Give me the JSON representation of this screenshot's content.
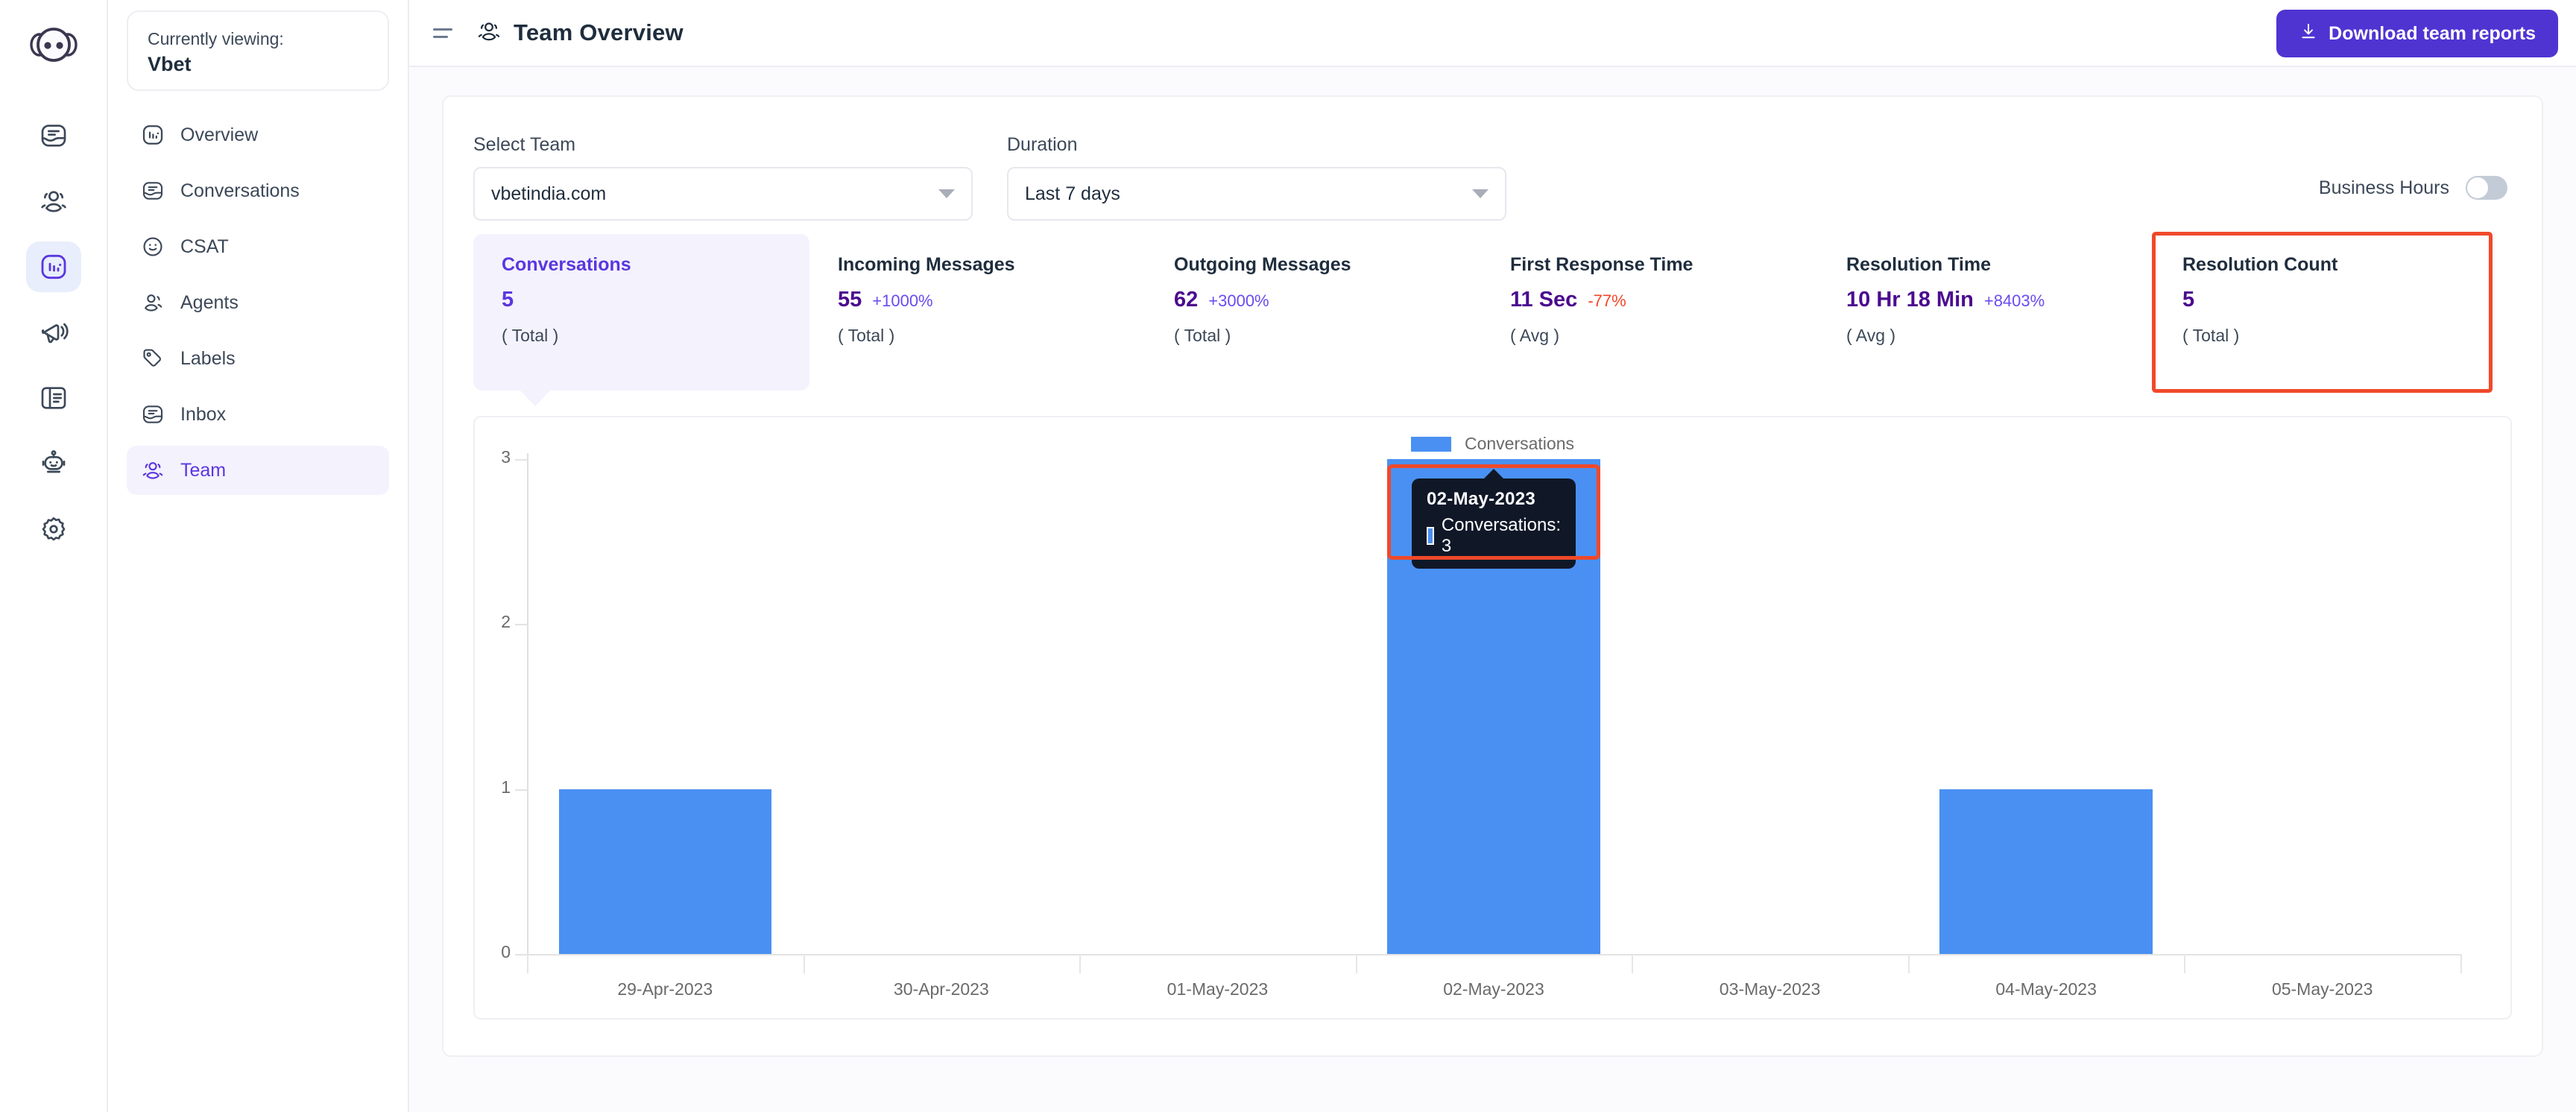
{
  "rail": {
    "logo_icon": "chatwoot-logo-icon",
    "items": [
      {
        "icon": "inbox-icon",
        "name": "inbox",
        "active": false
      },
      {
        "icon": "contacts-icon",
        "name": "contacts",
        "active": false
      },
      {
        "icon": "reports-bar-chart-icon",
        "name": "reports",
        "active": true
      },
      {
        "icon": "campaigns-megaphone-icon",
        "name": "campaigns",
        "active": false
      },
      {
        "icon": "help-center-portal-icon",
        "name": "portal",
        "active": false
      },
      {
        "icon": "bot-icon",
        "name": "bot",
        "active": false
      },
      {
        "icon": "gear-icon",
        "name": "settings",
        "active": false
      }
    ]
  },
  "sidebar": {
    "viewing_label": "Currently viewing:",
    "viewing_name": "Vbet",
    "items": [
      {
        "label": "Overview",
        "icon": "bar-chart-icon",
        "active": false
      },
      {
        "label": "Conversations",
        "icon": "inbox-icon",
        "active": false
      },
      {
        "label": "CSAT",
        "icon": "smiley-icon",
        "active": false
      },
      {
        "label": "Agents",
        "icon": "agent-icon",
        "active": false
      },
      {
        "label": "Labels",
        "icon": "tag-icon",
        "active": false
      },
      {
        "label": "Inbox",
        "icon": "inbox-icon",
        "active": false
      },
      {
        "label": "Team",
        "icon": "team-icon",
        "active": true
      }
    ]
  },
  "header": {
    "menu_icon": "hamburger-icon",
    "title_icon": "team-icon",
    "title": "Team Overview",
    "download_icon": "download-icon",
    "download_label": "Download team reports",
    "accent_color": "#4f34d2"
  },
  "filters": {
    "team": {
      "label": "Select Team",
      "value": "vbetindia.com"
    },
    "duration": {
      "label": "Duration",
      "value": "Last 7 days"
    },
    "business_hours": {
      "label": "Business Hours",
      "enabled": false
    }
  },
  "metrics": [
    {
      "name": "Conversations",
      "value": "5",
      "delta": "",
      "delta_sign": "",
      "sub": "( Total )",
      "active": true,
      "boxed": false
    },
    {
      "name": "Incoming Messages",
      "value": "55",
      "delta": "+1000%",
      "delta_sign": "pos",
      "sub": "( Total )",
      "active": false,
      "boxed": false
    },
    {
      "name": "Outgoing Messages",
      "value": "62",
      "delta": "+3000%",
      "delta_sign": "pos",
      "sub": "( Total )",
      "active": false,
      "boxed": false
    },
    {
      "name": "First Response Time",
      "value": "11 Sec",
      "delta": "-77%",
      "delta_sign": "neg",
      "sub": "( Avg )",
      "active": false,
      "boxed": false
    },
    {
      "name": "Resolution Time",
      "value": "10 Hr 18 Min",
      "delta": "+8403%",
      "delta_sign": "pos",
      "sub": "( Avg )",
      "active": false,
      "boxed": false
    },
    {
      "name": "Resolution Count",
      "value": "5",
      "delta": "",
      "delta_sign": "",
      "sub": "( Total )",
      "active": false,
      "boxed": true
    }
  ],
  "chart_data": {
    "type": "bar",
    "title": "",
    "xlabel": "",
    "ylabel": "",
    "legend": [
      {
        "name": "Conversations",
        "color": "#4a90f2"
      }
    ],
    "legend_position": "top-center",
    "grid": true,
    "ylim": [
      0,
      3
    ],
    "yticks": [
      "0",
      "1",
      "2",
      "3"
    ],
    "categories": [
      "29-Apr-2023",
      "30-Apr-2023",
      "01-May-2023",
      "02-May-2023",
      "03-May-2023",
      "04-May-2023",
      "05-May-2023"
    ],
    "series": [
      {
        "name": "Conversations",
        "values": [
          1,
          0,
          0,
          3,
          0,
          1,
          0
        ]
      }
    ]
  },
  "tooltip": {
    "date": "02-May-2023",
    "series_label": "Conversations: 3",
    "swatch_color": "#4a90f2"
  },
  "highlight_color": "#f0492a"
}
